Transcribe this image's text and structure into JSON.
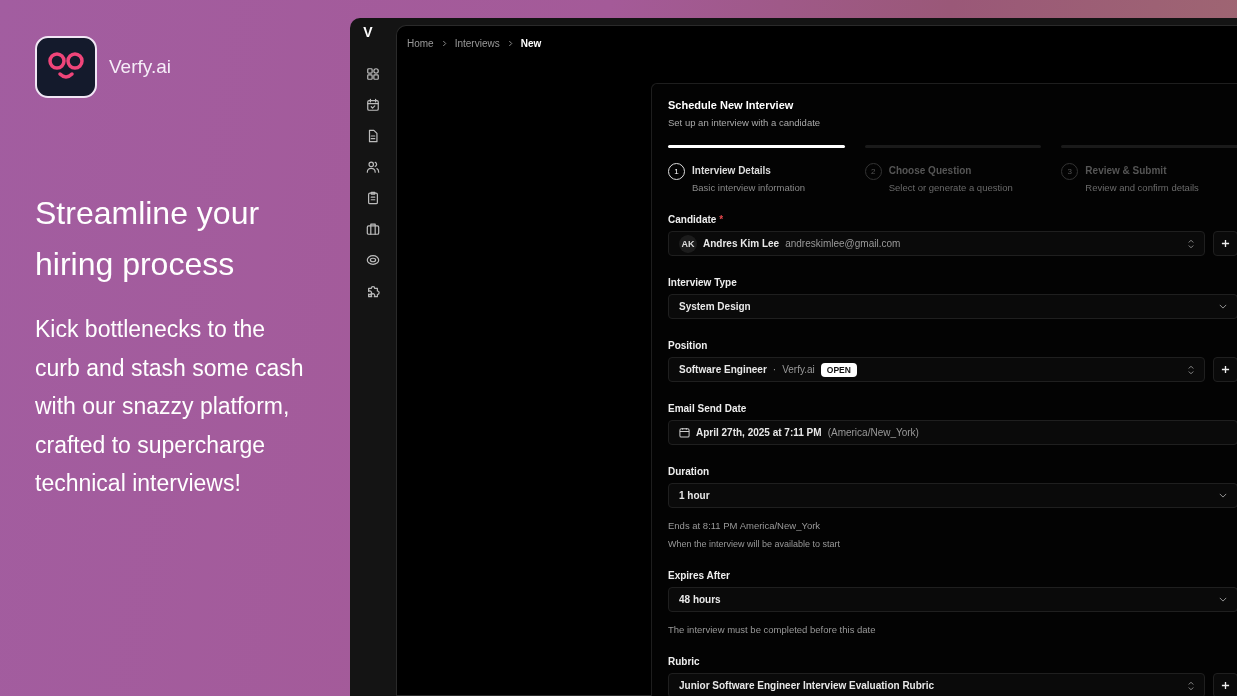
{
  "brand": {
    "name": "Verfy.ai"
  },
  "hero": {
    "headline": "Streamline your hiring process",
    "body": "Kick bottlenecks to the curb and stash some cash with our snazzy platform, crafted to supercharge technical interviews!"
  },
  "app": {
    "logo_letter": "V",
    "sidebar": {
      "icons": [
        {
          "kind": "grid"
        },
        {
          "kind": "calendar"
        },
        {
          "kind": "document"
        },
        {
          "kind": "users"
        },
        {
          "kind": "clipboard"
        },
        {
          "kind": "briefcase"
        },
        {
          "kind": "eye"
        },
        {
          "kind": "puzzle"
        }
      ]
    },
    "breadcrumb": [
      {
        "label": "Home",
        "current": false
      },
      {
        "label": "Interviews",
        "current": false
      },
      {
        "label": "New",
        "current": true
      }
    ],
    "form": {
      "title": "Schedule New Interview",
      "subtitle": "Set up an interview with a candidate",
      "steps": [
        {
          "number": "1",
          "title": "Interview Details",
          "subtitle": "Basic interview information",
          "selected": true
        },
        {
          "number": "2",
          "title": "Choose Question",
          "subtitle": "Select or generate a question",
          "selected": false
        },
        {
          "number": "3",
          "title": "Review & Submit",
          "subtitle": "Review and confirm details",
          "selected": false
        }
      ],
      "fields": [
        {
          "kind": "candidate",
          "label": "Candidate",
          "required_mark": "*",
          "initials": "AK",
          "value": "Andres Kim Lee",
          "detail": "andreskimlee@gmail.com",
          "add_button": true
        },
        {
          "kind": "select",
          "label": "Interview Type",
          "value": "System Design",
          "add_button": false
        },
        {
          "kind": "position",
          "label": "Position",
          "value": "Software Engineer",
          "separator": "·",
          "detail": "Verfy.ai",
          "badge": "OPEN",
          "add_button": true
        },
        {
          "kind": "date",
          "label": "Email Send Date",
          "value": "April 27th, 2025 at 7:11 PM",
          "detail": "(America/New_York)",
          "add_button": false
        },
        {
          "kind": "select",
          "label": "Duration",
          "value": "1 hour",
          "add_button": false,
          "hints": [
            "Ends at 8:11 PM America/New_York",
            "When the interview will be available to start"
          ]
        },
        {
          "kind": "select",
          "label": "Expires After",
          "value": "48 hours",
          "add_button": false,
          "hints": [
            "The interview must be completed before this date"
          ]
        },
        {
          "kind": "combobox",
          "label": "Rubric",
          "value": "Junior Software Engineer Interview Evaluation Rubric",
          "add_button": true
        }
      ]
    }
  }
}
